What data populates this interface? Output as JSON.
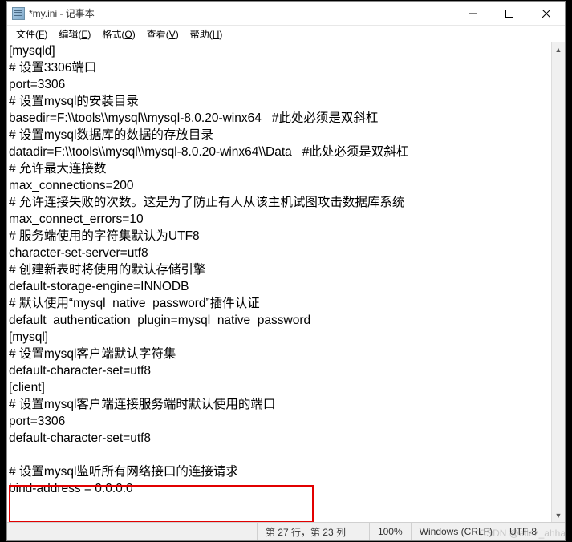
{
  "title": "*my.ini - 记事本",
  "menus": {
    "file": "文件(F)",
    "edit": "编辑(E)",
    "format": "格式(O)",
    "view": "查看(V)",
    "help": "帮助(H)"
  },
  "text_lines": [
    "[mysqld]",
    "# 设置3306端口",
    "port=3306",
    "# 设置mysql的安装目录",
    "basedir=F:\\\\tools\\\\mysql\\\\mysql-8.0.20-winx64   #此处必须是双斜杠",
    "# 设置mysql数据库的数据的存放目录",
    "datadir=F:\\\\tools\\\\mysql\\\\mysql-8.0.20-winx64\\\\Data   #此处必须是双斜杠",
    "# 允许最大连接数",
    "max_connections=200",
    "# 允许连接失败的次数。这是为了防止有人从该主机试图攻击数据库系统",
    "max_connect_errors=10",
    "# 服务端使用的字符集默认为UTF8",
    "character-set-server=utf8",
    "# 创建新表时将使用的默认存储引擎",
    "default-storage-engine=INNODB",
    "# 默认使用“mysql_native_password”插件认证",
    "default_authentication_plugin=mysql_native_password",
    "[mysql]",
    "# 设置mysql客户端默认字符集",
    "default-character-set=utf8",
    "[client]",
    "# 设置mysql客户端连接服务端时默认使用的端口",
    "port=3306",
    "default-character-set=utf8",
    "",
    "# 设置mysql监听所有网络接口的连接请求",
    "bind-address = 0.0.0.0"
  ],
  "status": {
    "position": "第 27 行，第 23 列",
    "zoom": "100%",
    "line_ending": "Windows (CRLF)",
    "encoding": "UTF-8"
  },
  "watermark": "CSDN @allez_ahha"
}
